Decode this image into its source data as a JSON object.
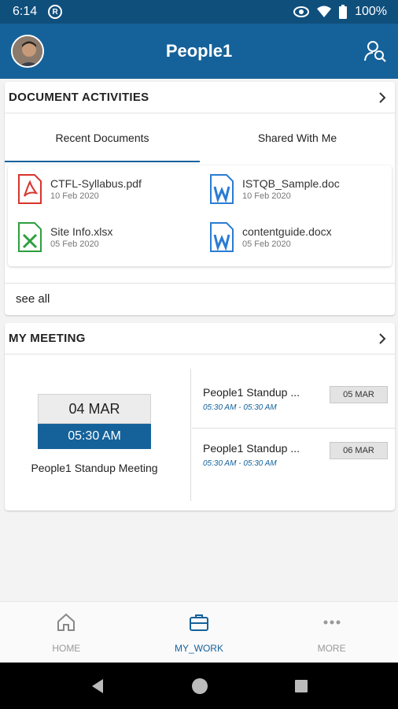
{
  "status_bar": {
    "time": "6:14",
    "battery": "100%"
  },
  "app_bar": {
    "title": "People1"
  },
  "documents": {
    "header": "DOCUMENT ACTIVITIES",
    "tabs": [
      {
        "label": "Recent Documents",
        "active": true
      },
      {
        "label": "Shared With Me",
        "active": false
      }
    ],
    "files": [
      {
        "name": "CTFL-Syllabus.pdf",
        "date": "10 Feb 2020",
        "icon": "pdf-file-icon"
      },
      {
        "name": "ISTQB_Sample.doc",
        "date": "10 Feb 2020",
        "icon": "word-file-icon"
      },
      {
        "name": "Site Info.xlsx",
        "date": "05 Feb 2020",
        "icon": "excel-file-icon"
      },
      {
        "name": "contentguide.docx",
        "date": "05 Feb 2020",
        "icon": "word-file-icon"
      }
    ],
    "see_all": "see all"
  },
  "meeting": {
    "header": "MY MEETING",
    "featured": {
      "date": "04 MAR",
      "time": "05:30 AM",
      "title": "People1 Standup Meeting"
    },
    "list": [
      {
        "title": "People1 Standup ...",
        "time": "05:30 AM - 05:30 AM",
        "date": "05 MAR"
      },
      {
        "title": "People1 Standup ...",
        "time": "05:30 AM - 05:30 AM",
        "date": "06 MAR"
      }
    ]
  },
  "bottom_nav": [
    {
      "label": "HOME",
      "icon": "home-icon",
      "active": false
    },
    {
      "label": "MY_WORK",
      "icon": "briefcase-icon",
      "active": true
    },
    {
      "label": "MORE",
      "icon": "more-dots-icon",
      "active": false
    }
  ],
  "colors": {
    "primary": "#15629a",
    "status_bar": "#0f4f7c",
    "pdf": "#d9342b",
    "word": "#2b7cd3",
    "excel": "#2e9e3e"
  }
}
